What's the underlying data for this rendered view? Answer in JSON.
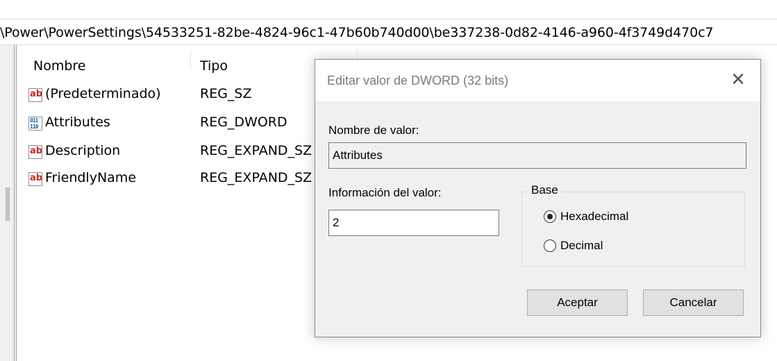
{
  "address_bar": {
    "path": "\\Power\\PowerSettings\\54533251-82be-4824-96c1-47b60b740d00\\be337238-0d82-4146-a960-4f3749d470c7"
  },
  "list": {
    "columns": {
      "name": "Nombre",
      "type": "Tipo"
    },
    "rows": [
      {
        "icon": "string-value-icon",
        "glyph": "ab",
        "name": "(Predeterminado)",
        "type": "REG_SZ"
      },
      {
        "icon": "binary-value-icon",
        "glyph": "011\n110",
        "name": "Attributes",
        "type": "REG_DWORD"
      },
      {
        "icon": "string-value-icon",
        "glyph": "ab",
        "name": "Description",
        "type": "REG_EXPAND_SZ"
      },
      {
        "icon": "string-value-icon",
        "glyph": "ab",
        "name": "FriendlyName",
        "type": "REG_EXPAND_SZ"
      }
    ]
  },
  "dialog": {
    "title": "Editar valor de DWORD (32 bits)",
    "close_glyph": "✕",
    "value_name_label": "Nombre de valor:",
    "value_name": "Attributes",
    "value_data_label": "Información del valor:",
    "value_data": "2",
    "base_label": "Base",
    "base_options": [
      "Hexadecimal",
      "Decimal"
    ],
    "base_selected": "Hexadecimal",
    "ok_label": "Aceptar",
    "cancel_label": "Cancelar"
  },
  "colors": {
    "dialog_bg": "#f0f0f0",
    "string_icon_text": "#c42b1c",
    "binary_icon_text": "#1a5fb4"
  }
}
